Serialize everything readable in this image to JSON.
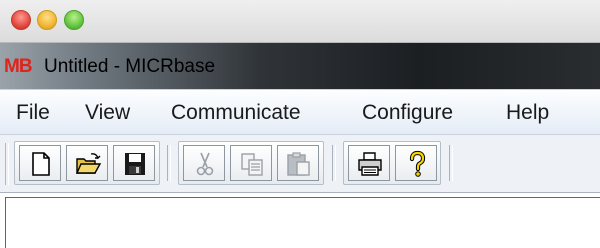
{
  "window": {
    "app_icon_text": "MB",
    "title": "Untitled - MICRbase"
  },
  "menubar": {
    "items": [
      "File",
      "View",
      "Communicate",
      "Configure",
      "Help"
    ]
  },
  "toolbar": {
    "buttons": [
      {
        "icon": "new-document-icon",
        "enabled": true
      },
      {
        "icon": "open-folder-icon",
        "enabled": true
      },
      {
        "icon": "save-disk-icon",
        "enabled": true
      },
      {
        "icon": "cut-icon",
        "enabled": false
      },
      {
        "icon": "copy-icon",
        "enabled": false
      },
      {
        "icon": "paste-icon",
        "enabled": false
      },
      {
        "icon": "print-icon",
        "enabled": true
      },
      {
        "icon": "help-icon",
        "enabled": true
      }
    ]
  },
  "colors": {
    "app_icon": "#e0241c",
    "menubar": "#eef3fa",
    "toolbar": "#eef1f5",
    "disabled_icon": "#9aa0a6"
  }
}
